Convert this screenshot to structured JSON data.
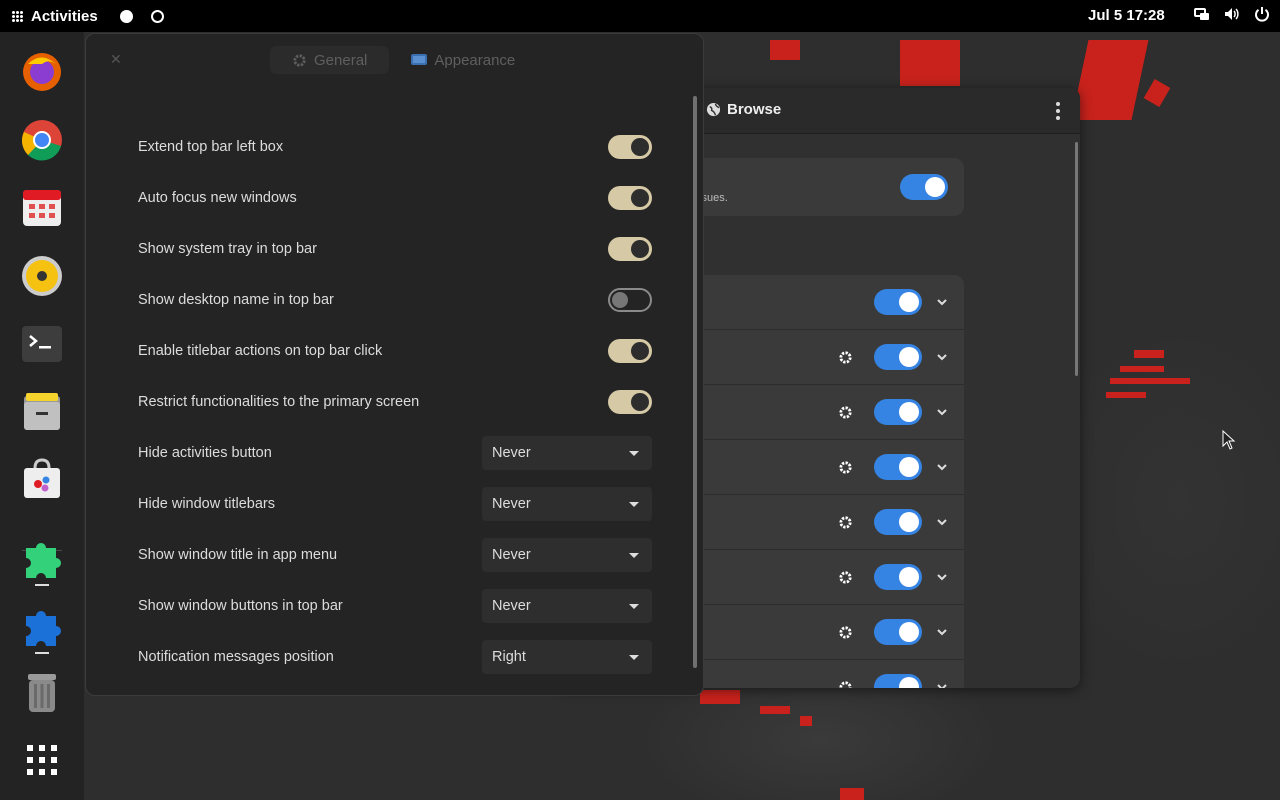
{
  "topbar": {
    "activities_label": "Activities",
    "clock": "Jul 5  17:28",
    "tray_icons": [
      "network-icon",
      "volume-icon",
      "power-icon"
    ]
  },
  "dock": {
    "apps": [
      "firefox-icon",
      "chrome-icon",
      "calendar-icon",
      "rhythmbox-icon",
      "terminal-icon",
      "files-icon",
      "software-icon",
      "extension-manager-icon",
      "extensions-icon",
      "trash-icon",
      "show-apps-icon"
    ]
  },
  "extensions_window": {
    "header_title": "Browse",
    "notice_text": "ssues."
  },
  "settings": {
    "tabs": [
      {
        "label": "General",
        "icon": "gear-icon"
      },
      {
        "label": "Appearance",
        "icon": "display-icon"
      }
    ],
    "toggles": [
      {
        "label": "Extend top bar left box",
        "on": true
      },
      {
        "label": "Auto focus new windows",
        "on": true
      },
      {
        "label": "Show system tray in top bar",
        "on": true
      },
      {
        "label": "Show desktop name in top bar",
        "on": false
      },
      {
        "label": "Enable titlebar actions on top bar click",
        "on": true
      },
      {
        "label": "Restrict functionalities to the primary screen",
        "on": true
      }
    ],
    "dropdowns": [
      {
        "label": "Hide activities button",
        "value": "Never"
      },
      {
        "label": "Hide window titlebars",
        "value": "Never"
      },
      {
        "label": "Show window title in app menu",
        "value": "Never"
      },
      {
        "label": "Show window buttons in top bar",
        "value": "Never"
      },
      {
        "label": "Notification messages position",
        "value": "Right"
      }
    ]
  },
  "colors": {
    "accent_blue": "#3584e4",
    "toggle_on": "#d6c9a5",
    "topbar": "#000000"
  }
}
